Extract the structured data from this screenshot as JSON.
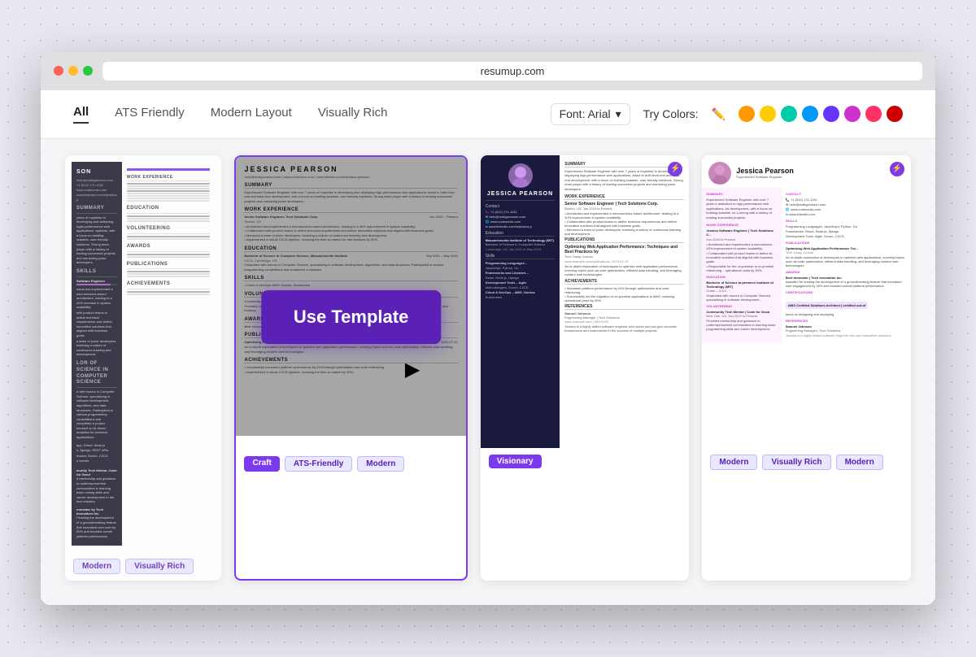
{
  "browser": {
    "url": "resumup.com"
  },
  "nav": {
    "tabs": [
      {
        "id": "all",
        "label": "All",
        "active": true
      },
      {
        "id": "ats",
        "label": "ATS Friendly"
      },
      {
        "id": "modern",
        "label": "Modern Layout"
      },
      {
        "id": "visually",
        "label": "Visually Rich"
      }
    ],
    "font_label": "Font: Arial",
    "color_label": "Try Colors:",
    "colors": [
      "#ff4444",
      "#ff9900",
      "#ffcc00",
      "#00ccaa",
      "#0099ff",
      "#6633ff",
      "#cc33cc",
      "#ff3366",
      "#cc0000"
    ]
  },
  "cta": {
    "use_template": "Use Template"
  },
  "cards": [
    {
      "id": "card1",
      "name": "Jessica Pearson partial",
      "tags": [
        "Modern",
        "Visually Rich"
      ]
    },
    {
      "id": "card2",
      "name": "Jessica Pearson clean",
      "tags": [
        "Craft",
        "ATS-Friendly",
        "Modern"
      ]
    },
    {
      "id": "card3",
      "name": "Jessica Pearson sidebar",
      "tags": [
        "Visionary"
      ]
    },
    {
      "id": "card4",
      "name": "Jessica Pearson creative",
      "tags": [
        "Modern",
        "Visually Rich",
        "Modern"
      ]
    }
  ],
  "resume": {
    "name": "JESSICA PEARSON",
    "name2": "Jessica Pearson",
    "email": "hello@mailypearson.com",
    "phone": "+1 (512) 171-1241",
    "website": "www.codesonks.com",
    "linkedin": "www.linkedin.com/in/jessica-pearson",
    "sections": {
      "summary": "Summary",
      "work_experience": "Work Experience",
      "education": "Education",
      "skills": "Skills",
      "volunteering": "Volunteering",
      "awards": "Awards",
      "publications": "Publications",
      "achievements": "Achievements",
      "references": "References",
      "certifications": "Certifications"
    }
  }
}
